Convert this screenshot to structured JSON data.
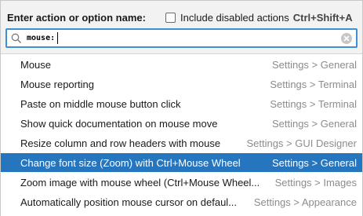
{
  "header": {
    "title": "Enter action or option name:",
    "include_disabled_label": "Include disabled actions",
    "include_disabled_shortcut": "Ctrl+Shift+A",
    "include_disabled_checked": false
  },
  "search": {
    "value": "mouse:",
    "placeholder": ""
  },
  "results": [
    {
      "label": "Mouse",
      "location": "Settings > General",
      "selected": false
    },
    {
      "label": "Mouse reporting",
      "location": "Settings > Terminal",
      "selected": false
    },
    {
      "label": "Paste on middle mouse button click",
      "location": "Settings > Terminal",
      "selected": false
    },
    {
      "label": "Show quick documentation on mouse move",
      "location": "Settings > General",
      "selected": false
    },
    {
      "label": "Resize column and row headers with mouse",
      "location": "Settings > GUI Designer",
      "selected": false
    },
    {
      "label": "Change font size (Zoom) with Ctrl+Mouse Wheel",
      "location": "Settings > General",
      "selected": true
    },
    {
      "label": "Zoom image with mouse wheel (Ctrl+Mouse Wheel...",
      "location": "Settings > Images",
      "selected": false
    },
    {
      "label": "Automatically position mouse cursor on defaul...",
      "location": "Settings > Appearance",
      "selected": false
    }
  ],
  "colors": {
    "selection": "#2675bf",
    "search_border": "#3f8fd6",
    "location_text": "#8c8c8c"
  },
  "icons": {
    "search": "search-icon",
    "clear": "clear-icon"
  }
}
